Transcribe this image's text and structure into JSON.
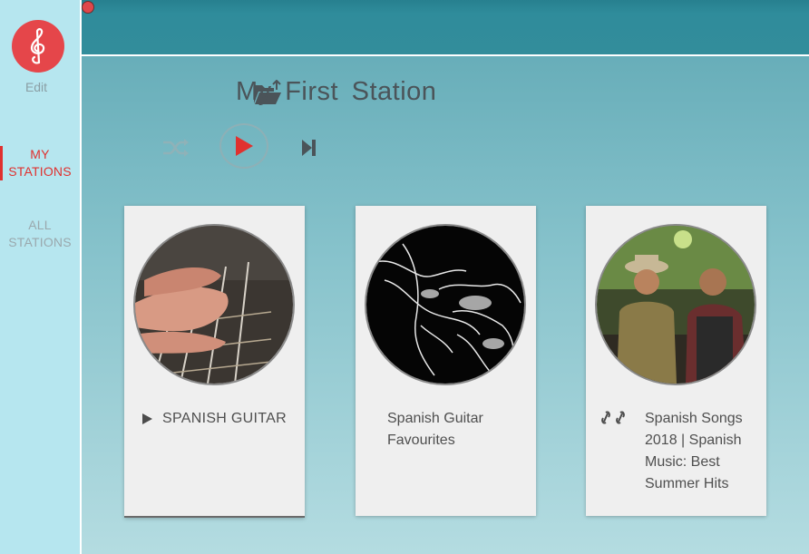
{
  "sidebar": {
    "edit_label": "Edit",
    "nav": [
      {
        "label": "MY STATIONS",
        "active": true
      },
      {
        "label": "ALL STATIONS",
        "active": false
      }
    ],
    "logo_icon": "treble-clef-icon"
  },
  "station": {
    "title": "My First Station"
  },
  "player": {
    "shuffle_icon": "shuffle-icon",
    "play_icon": "play-icon",
    "next_icon": "skip-next-icon"
  },
  "cards": [
    {
      "title": "SPANISH GUITAR",
      "icon": "play-icon",
      "type": "playlist"
    },
    {
      "title": "Spanish Guitar Favourites",
      "icon": "",
      "type": "station"
    },
    {
      "title": "Spanish Songs 2018 | Spanish Music: Best Summer Hits",
      "icon": "link-icon",
      "type": "link"
    }
  ],
  "colors": {
    "accent_red": "#e0312f",
    "logo_red": "#e5464a",
    "sidebar_bg": "#b6e6ef",
    "topbar": "#2f8c9b"
  }
}
